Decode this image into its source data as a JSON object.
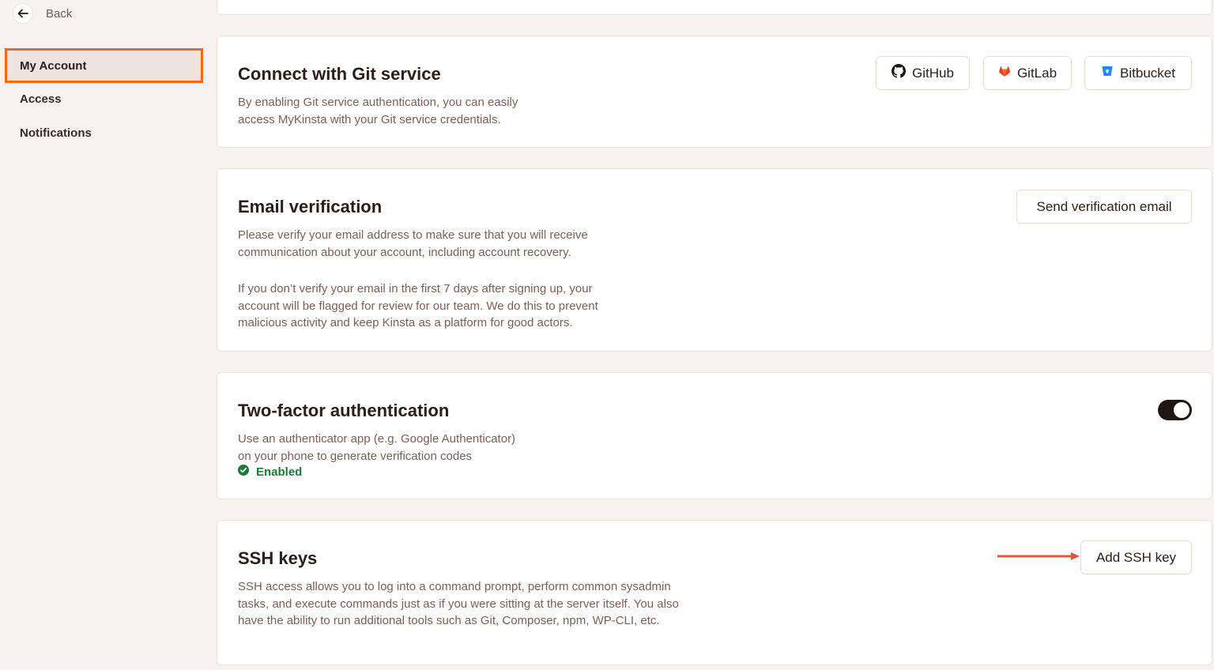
{
  "sidebar": {
    "back_label": "Back",
    "items": [
      {
        "label": "My Account",
        "active": true
      },
      {
        "label": "Access",
        "active": false
      },
      {
        "label": "Notifications",
        "active": false
      }
    ]
  },
  "cards": {
    "git": {
      "title": "Connect with Git service",
      "description_line1": "By enabling Git service authentication, you can easily",
      "description_line2": "access MyKinsta with your Git service credentials.",
      "buttons": {
        "github": "GitHub",
        "gitlab": "GitLab",
        "bitbucket": "Bitbucket"
      }
    },
    "email": {
      "title": "Email verification",
      "description_p1_line1": "Please verify your email address to make sure that you will receive",
      "description_p1_line2": "communication about your account, including account recovery.",
      "description_p2_line1": "If you don’t verify your email in the first 7 days after signing up, your",
      "description_p2_line2": "account will be flagged for review for our team. We do this to prevent",
      "description_p2_line3": "malicious activity and keep Kinsta as a platform for good actors.",
      "button_label": "Send verification email"
    },
    "twofa": {
      "title": "Two-factor authentication",
      "description_line1": "Use an authenticator app (e.g. Google Authenticator)",
      "description_line2": "on your phone to generate verification codes",
      "status": "Enabled",
      "toggle_on": true
    },
    "ssh": {
      "title": "SSH keys",
      "description_line1": "SSH access allows you to log into a command prompt, perform common sysadmin",
      "description_line2": "tasks, and execute commands just as if you were sitting at the server itself. You also",
      "description_line3": "have the ability to run additional tools such as Git, Composer, npm, WP-CLI, etc.",
      "button_label": "Add SSH key"
    }
  },
  "colors": {
    "highlight": "#f26a21",
    "arrow": "#e8573d",
    "enabled": "#1d7a3c",
    "gitlab": "#e24329",
    "bitbucket": "#2684ff"
  }
}
